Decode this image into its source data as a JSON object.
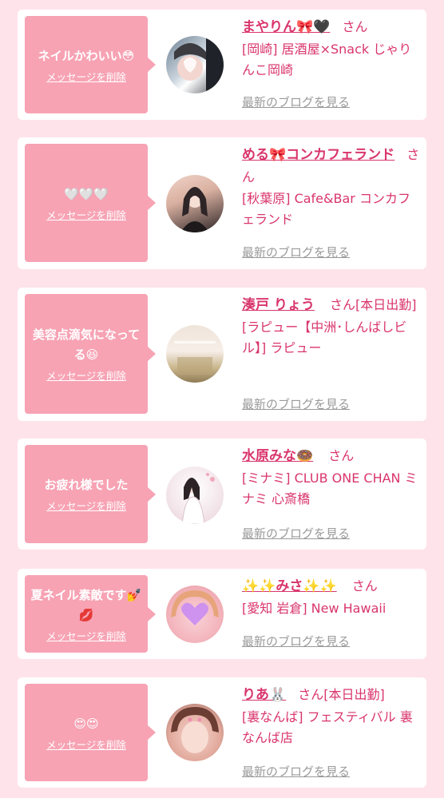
{
  "colors": {
    "background": "#ffe3ea",
    "card": "#ffffff",
    "bubble": "#f7a3b4",
    "accent_text": "#d9356c",
    "link_gray": "#9a9a9a"
  },
  "delete_label": "メッセージを削除",
  "blog_label": "最新のブログを見る",
  "san_label": "さん",
  "items": [
    {
      "message": "ネイルかわいい😳",
      "name": "まやりん🎀🖤",
      "suffix": "さん",
      "shop": "[岡崎] 居酒屋×Snack じゃりんこ岡崎",
      "blog": "最新のブログを見る",
      "delete": "メッセージを削除",
      "avatar": "avatar-photo-1"
    },
    {
      "message": "🤍🤍🤍",
      "name": "める🎀コンカフェランド",
      "suffix": "さん",
      "shop": "[秋葉原] Cafe&Bar コンカフェランド",
      "blog": "最新のブログを見る",
      "delete": "メッセージを削除",
      "avatar": "avatar-photo-2"
    },
    {
      "message": "美容点滴気になってる😆",
      "name": "湊戸 りょう",
      "suffix": "さん[本日出勤]",
      "shop": "[ラピュー【中洲･しんばしビル】] ラピュー",
      "blog": "最新のブログを見る",
      "delete": "メッセージを削除",
      "avatar": "avatar-photo-3"
    },
    {
      "message": "お疲れ様でした",
      "name": "水原みな🍩",
      "suffix": "さん",
      "shop": "[ミナミ] CLUB ONE CHAN ミナミ 心斎橋",
      "blog": "最新のブログを見る",
      "delete": "メッセージを削除",
      "avatar": "avatar-photo-4"
    },
    {
      "message": "夏ネイル素敵です💅💋",
      "name": "✨✨みさ✨✨",
      "suffix": "さん",
      "shop": "[愛知 岩倉] New Hawaii",
      "blog": "最新のブログを見る",
      "delete": "メッセージを削除",
      "avatar": "avatar-photo-5"
    },
    {
      "message": "😍😍",
      "name": "りあ🐰",
      "suffix": "さん[本日出勤]",
      "shop": "[裏なんば] フェスティバル 裏なんば店",
      "blog": "最新のブログを見る",
      "delete": "メッセージを削除",
      "avatar": "avatar-photo-6"
    }
  ]
}
